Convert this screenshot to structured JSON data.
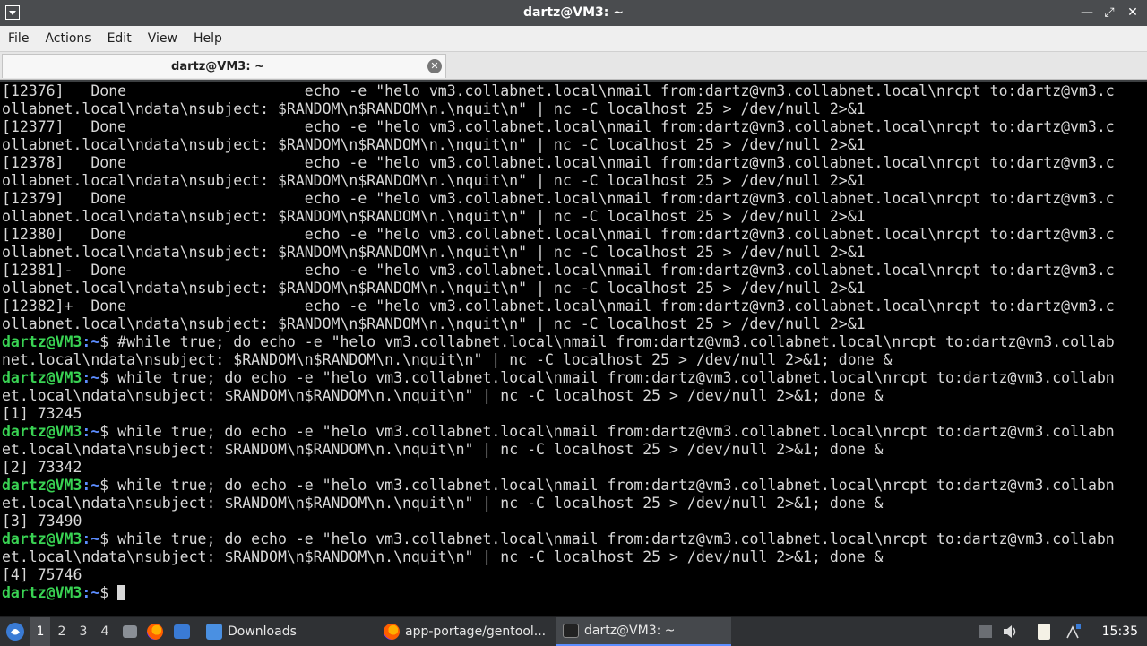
{
  "window": {
    "title": "dartz@VM3: ~"
  },
  "menubar": [
    "File",
    "Actions",
    "Edit",
    "View",
    "Help"
  ],
  "tab": {
    "label": "dartz@VM3: ~"
  },
  "terminal": {
    "lines": [
      {
        "t": "[12376]   Done                    echo -e \"helo vm3.collabnet.local\\nmail from:dartz@vm3.collabnet.local\\nrcpt to:dartz@vm3.c"
      },
      {
        "t": "ollabnet.local\\ndata\\nsubject: $RANDOM\\n$RANDOM\\n.\\nquit\\n\" | nc -C localhost 25 > /dev/null 2>&1"
      },
      {
        "t": "[12377]   Done                    echo -e \"helo vm3.collabnet.local\\nmail from:dartz@vm3.collabnet.local\\nrcpt to:dartz@vm3.c"
      },
      {
        "t": "ollabnet.local\\ndata\\nsubject: $RANDOM\\n$RANDOM\\n.\\nquit\\n\" | nc -C localhost 25 > /dev/null 2>&1"
      },
      {
        "t": "[12378]   Done                    echo -e \"helo vm3.collabnet.local\\nmail from:dartz@vm3.collabnet.local\\nrcpt to:dartz@vm3.c"
      },
      {
        "t": "ollabnet.local\\ndata\\nsubject: $RANDOM\\n$RANDOM\\n.\\nquit\\n\" | nc -C localhost 25 > /dev/null 2>&1"
      },
      {
        "t": "[12379]   Done                    echo -e \"helo vm3.collabnet.local\\nmail from:dartz@vm3.collabnet.local\\nrcpt to:dartz@vm3.c"
      },
      {
        "t": "ollabnet.local\\ndata\\nsubject: $RANDOM\\n$RANDOM\\n.\\nquit\\n\" | nc -C localhost 25 > /dev/null 2>&1"
      },
      {
        "t": "[12380]   Done                    echo -e \"helo vm3.collabnet.local\\nmail from:dartz@vm3.collabnet.local\\nrcpt to:dartz@vm3.c"
      },
      {
        "t": "ollabnet.local\\ndata\\nsubject: $RANDOM\\n$RANDOM\\n.\\nquit\\n\" | nc -C localhost 25 > /dev/null 2>&1"
      },
      {
        "t": "[12381]-  Done                    echo -e \"helo vm3.collabnet.local\\nmail from:dartz@vm3.collabnet.local\\nrcpt to:dartz@vm3.c"
      },
      {
        "t": "ollabnet.local\\ndata\\nsubject: $RANDOM\\n$RANDOM\\n.\\nquit\\n\" | nc -C localhost 25 > /dev/null 2>&1"
      },
      {
        "t": "[12382]+  Done                    echo -e \"helo vm3.collabnet.local\\nmail from:dartz@vm3.collabnet.local\\nrcpt to:dartz@vm3.c"
      },
      {
        "t": "ollabnet.local\\ndata\\nsubject: $RANDOM\\n$RANDOM\\n.\\nquit\\n\" | nc -C localhost 25 > /dev/null 2>&1"
      },
      {
        "p": true,
        "t": "#while true; do echo -e \"helo vm3.collabnet.local\\nmail from:dartz@vm3.collabnet.local\\nrcpt to:dartz@vm3.collab"
      },
      {
        "t": "net.local\\ndata\\nsubject: $RANDOM\\n$RANDOM\\n.\\nquit\\n\" | nc -C localhost 25 > /dev/null 2>&1; done &"
      },
      {
        "p": true,
        "t": "while true; do echo -e \"helo vm3.collabnet.local\\nmail from:dartz@vm3.collabnet.local\\nrcpt to:dartz@vm3.collabn"
      },
      {
        "t": "et.local\\ndata\\nsubject: $RANDOM\\n$RANDOM\\n.\\nquit\\n\" | nc -C localhost 25 > /dev/null 2>&1; done &"
      },
      {
        "t": "[1] 73245"
      },
      {
        "p": true,
        "t": "while true; do echo -e \"helo vm3.collabnet.local\\nmail from:dartz@vm3.collabnet.local\\nrcpt to:dartz@vm3.collabn"
      },
      {
        "t": "et.local\\ndata\\nsubject: $RANDOM\\n$RANDOM\\n.\\nquit\\n\" | nc -C localhost 25 > /dev/null 2>&1; done &"
      },
      {
        "t": "[2] 73342"
      },
      {
        "p": true,
        "t": "while true; do echo -e \"helo vm3.collabnet.local\\nmail from:dartz@vm3.collabnet.local\\nrcpt to:dartz@vm3.collabn"
      },
      {
        "t": "et.local\\ndata\\nsubject: $RANDOM\\n$RANDOM\\n.\\nquit\\n\" | nc -C localhost 25 > /dev/null 2>&1; done &"
      },
      {
        "t": "[3] 73490"
      },
      {
        "p": true,
        "t": "while true; do echo -e \"helo vm3.collabnet.local\\nmail from:dartz@vm3.collabnet.local\\nrcpt to:dartz@vm3.collabn"
      },
      {
        "t": "et.local\\ndata\\nsubject: $RANDOM\\n$RANDOM\\n.\\nquit\\n\" | nc -C localhost 25 > /dev/null 2>&1; done &"
      },
      {
        "t": "[4] 75746"
      },
      {
        "p": true,
        "t": "",
        "cursor": true
      }
    ],
    "prompt_user": "dartz@VM3",
    "prompt_path": ":~",
    "prompt_sign": "$ "
  },
  "taskbar": {
    "workspaces": [
      "1",
      "2",
      "3",
      "4"
    ],
    "tasks": [
      {
        "label": "Downloads",
        "icon": "folder-icon"
      },
      {
        "label": "app-portage/gentool...",
        "icon": "firefox-icon"
      },
      {
        "label": "dartz@VM3: ~",
        "icon": "terminal-icon"
      }
    ],
    "clock": "15:35"
  },
  "colors": {
    "prompt_user": "#39d353",
    "prompt_path": "#5c8dff",
    "terminal_bg": "#000000"
  }
}
